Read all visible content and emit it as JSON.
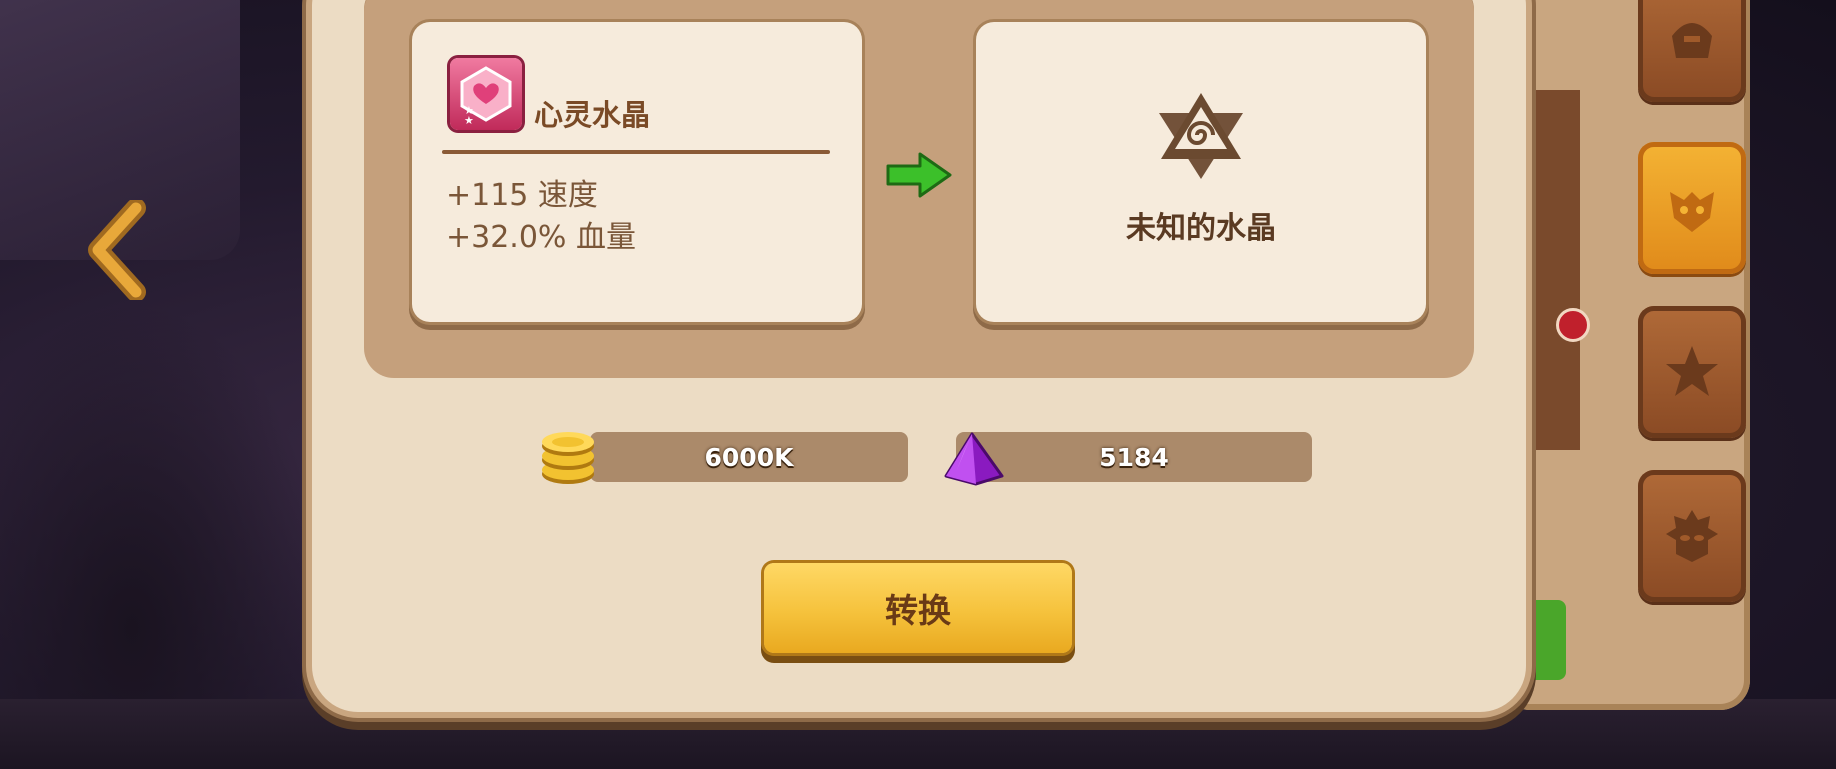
{
  "source_crystal": {
    "name": "心灵水晶",
    "stats": [
      "+115 速度",
      "+32.0% 血量"
    ]
  },
  "target_crystal": {
    "name": "未知的水晶"
  },
  "costs": {
    "gold": "6000K",
    "gems": "5184"
  },
  "convert_button": "转换",
  "icons": {
    "back": "back-arrow-icon",
    "crystal": "heart-crystal-icon",
    "arrow": "green-arrow-icon",
    "unknown": "unknown-crystal-icon",
    "gold": "gold-coin-icon",
    "gem": "purple-gem-icon",
    "tabs": [
      "helmet-icon",
      "mask-icon",
      "star-icon",
      "lion-mask-icon"
    ]
  },
  "colors": {
    "accent_button": "#f5c23c",
    "panel": "#ecdcc4",
    "card": "#f6ebdc",
    "arrow_green": "#3cc02a"
  }
}
